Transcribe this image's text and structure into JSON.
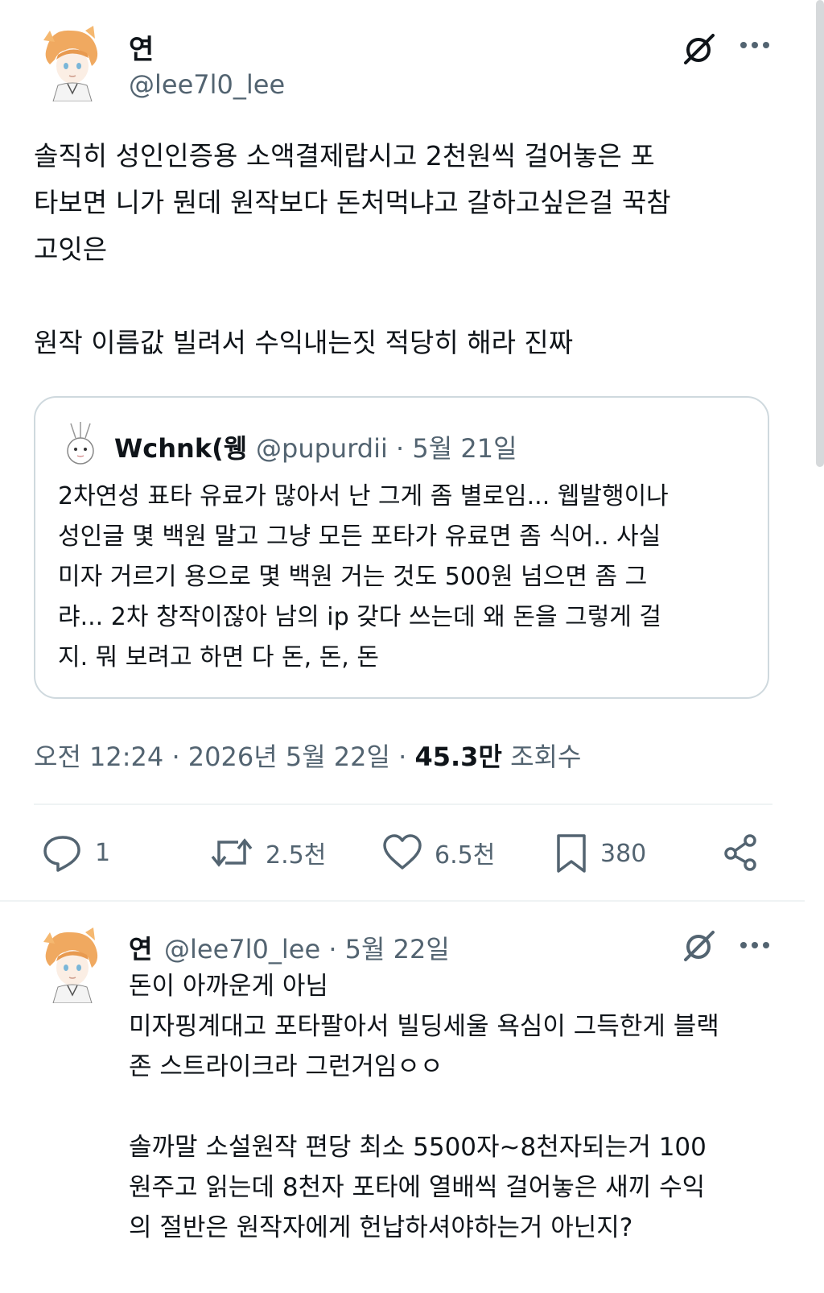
{
  "tweet": {
    "author_name": "연",
    "author_handle": "@lee7l0_lee",
    "text": "솔직히 성인인증용 소액결제랍시고 2천원씩 걸어놓은 포\n타보면 니가 뭔데 원작보다 돈처먹냐고 갈하고싶은걸 꾹참\n고잇은\n\n원작 이름값 빌려서 수익내는짓 적당히 해라 진짜",
    "timestamp": "오전 12:24 · 2026년 5월 22일 · ",
    "views_count": "45.3만",
    "views_label": " 조회수",
    "actions": {
      "replies": "1",
      "reposts": "2.5천",
      "likes": "6.5천",
      "bookmarks": "380"
    }
  },
  "quoted": {
    "author_name": "Wchnk(웽",
    "handle_date": "@pupurdii · 5월 21일",
    "text": "2차연성 표타 유료가 많아서 난 그게 좀 별로임... 웹발행이나\n성인글 몇 백원 말고 그냥 모든 포타가 유료면 좀 식어.. 사실\n미자 거르기 용으로 몇 백원 거는 것도 500원 넘으면 좀 그\n랴... 2차 창작이잖아 남의 ip 갖다 쓰는데 왜 돈을 그렇게 걸\n지. 뭐 보려고 하면 다 돈, 돈, 돈"
  },
  "reply": {
    "author_name": "연",
    "handle_date": "@lee7l0_lee · 5월 22일",
    "text": "돈이 아까운게 아님\n미자핑계대고 포타팔아서 빌딩세울 욕심이 그득한게 블랙\n존 스트라이크라 그런거임ㅇㅇ\n\n솔까말 소설원작 편당 최소 5500자~8천자되는거 100\n원주고 읽는데 8천자 포타에 열배씩 걸어놓은 새끼 수익\n의 절반은 원작자에게 헌납하셔야하는거 아닌지?"
  },
  "icons": {
    "grok": "grok-icon",
    "more": "more-icon",
    "reply": "reply-icon",
    "repost": "repost-icon",
    "like": "heart-icon",
    "bookmark": "bookmark-icon",
    "share": "share-icon"
  },
  "colors": {
    "text": "#0f1419",
    "secondary": "#536471",
    "border": "#cfd9de"
  }
}
